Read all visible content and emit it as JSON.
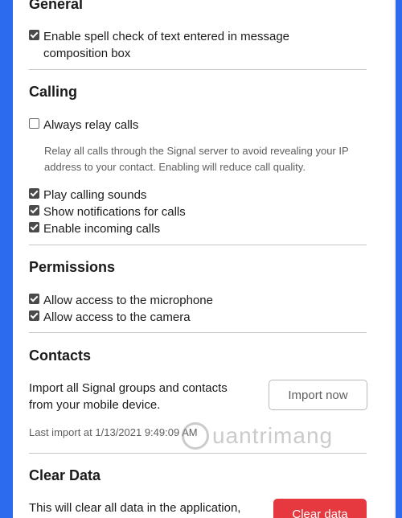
{
  "sections": {
    "general": {
      "heading": "General",
      "spellcheck_line1": "Enable spell check of text entered in message",
      "spellcheck_line2": "composition box"
    },
    "calling": {
      "heading": "Calling",
      "always_relay": "Always relay calls",
      "relay_desc_line1": "Relay all calls through the Signal server to avoid revealing your IP",
      "relay_desc_line2": "address to your contact. Enabling will reduce call quality.",
      "play_sounds": "Play calling sounds",
      "show_notifications": "Show notifications for calls",
      "incoming_calls": "Enable incoming calls"
    },
    "permissions": {
      "heading": "Permissions",
      "microphone": "Allow access to the microphone",
      "camera": "Allow access to the camera"
    },
    "contacts": {
      "heading": "Contacts",
      "import_desc_line1": "Import all Signal groups and contacts",
      "import_desc_line2": "from your mobile device.",
      "import_button": "Import now",
      "last_import": "Last import at 1/13/2021 9:49:09 AM"
    },
    "clear_data": {
      "heading": "Clear Data",
      "desc": "This will clear all data in the application,",
      "button": "Clear data"
    }
  },
  "checkbox_states": {
    "spellcheck": true,
    "always_relay": false,
    "play_sounds": true,
    "show_notifications": true,
    "incoming_calls": true,
    "microphone": true,
    "camera": true
  },
  "watermark": "uantrimang",
  "colors": {
    "background_accent": "#2c6bed",
    "danger_button": "#e5393f"
  }
}
